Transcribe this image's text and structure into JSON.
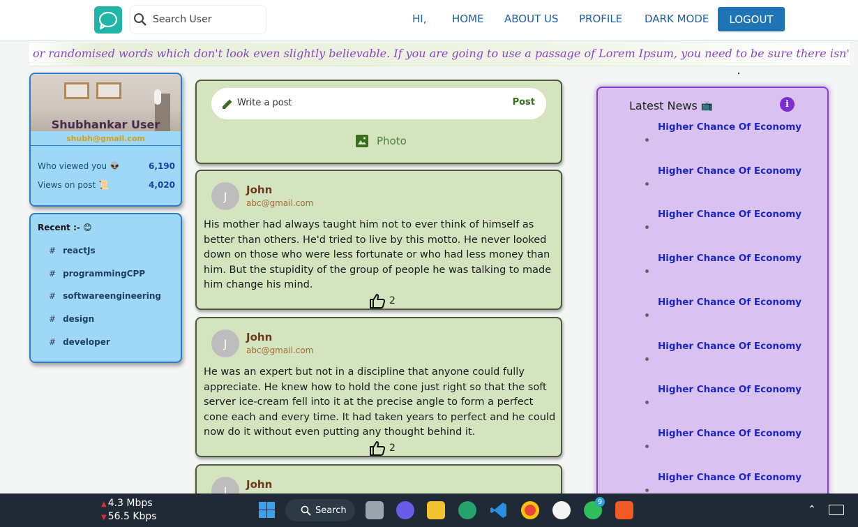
{
  "nav": {
    "search_placeholder": "Search User",
    "greeting": "HI,",
    "home": "HOME",
    "about": "ABOUT US",
    "profile": "PROFILE",
    "dark_mode": "DARK MODE",
    "logout": "LOGOUT"
  },
  "marquee": "or randomised words which don't look even slightly believable. If you are going to use a passage of Lorem Ipsum, you need to be sure there isn't anything em",
  "profile": {
    "name": "Shubhankar User",
    "email": "shubh@gmail.com",
    "stats": [
      {
        "label": "Who viewed you",
        "emoji": "👽",
        "value": "6,190"
      },
      {
        "label": "Views on post",
        "emoji": "📜",
        "value": "4,020"
      }
    ]
  },
  "recent": {
    "title": "Recent :-",
    "emoji": "😊",
    "tags": [
      "reactJs",
      "programmingCPP",
      "softwareengineering",
      "design",
      "developer"
    ]
  },
  "composer": {
    "placeholder": "Write a post",
    "post_label": "Post",
    "photo_label": "Photo"
  },
  "posts": [
    {
      "initial": "J",
      "author": "John",
      "email": "abc@gmail.com",
      "body": "His mother had always taught him not to ever think of himself as better than others. He'd tried to live by this motto. He never looked down on those who were less fortunate or who had less money than him. But the stupidity of the group of people he was talking to made him change his mind.",
      "likes": "2"
    },
    {
      "initial": "J",
      "author": "John",
      "email": "abc@gmail.com",
      "body": "He was an expert but not in a discipline that anyone could fully appreciate. He knew how to hold the cone just right so that the soft server ice-cream fell into it at the precise angle to form a perfect cone each and every time. It had taken years to perfect and he could now do it without even putting any thought behind it.",
      "likes": "2"
    },
    {
      "initial": "J",
      "author": "John",
      "email": "",
      "body": "",
      "likes": ""
    }
  ],
  "news": {
    "title": "Latest News",
    "emoji": "📺",
    "info": "i",
    "items": [
      "Higher Chance Of Economy",
      "Higher Chance Of Economy",
      "Higher Chance Of Economy",
      "Higher Chance Of Economy",
      "Higher Chance Of Economy",
      "Higher Chance Of Economy",
      "Higher Chance Of Economy",
      "Higher Chance Of Economy",
      "Higher Chance Of Economy"
    ]
  },
  "taskbar": {
    "upload": "4.3 Mbps",
    "download": "56.5 Kbps",
    "search": "Search",
    "whatsapp_badge": "9"
  },
  "colors": {
    "accent": "#1f74b5",
    "post_bg": "#d3e4bf",
    "sidebar_bg": "#9fd8f7",
    "news_bg": "#d9c2ef"
  }
}
